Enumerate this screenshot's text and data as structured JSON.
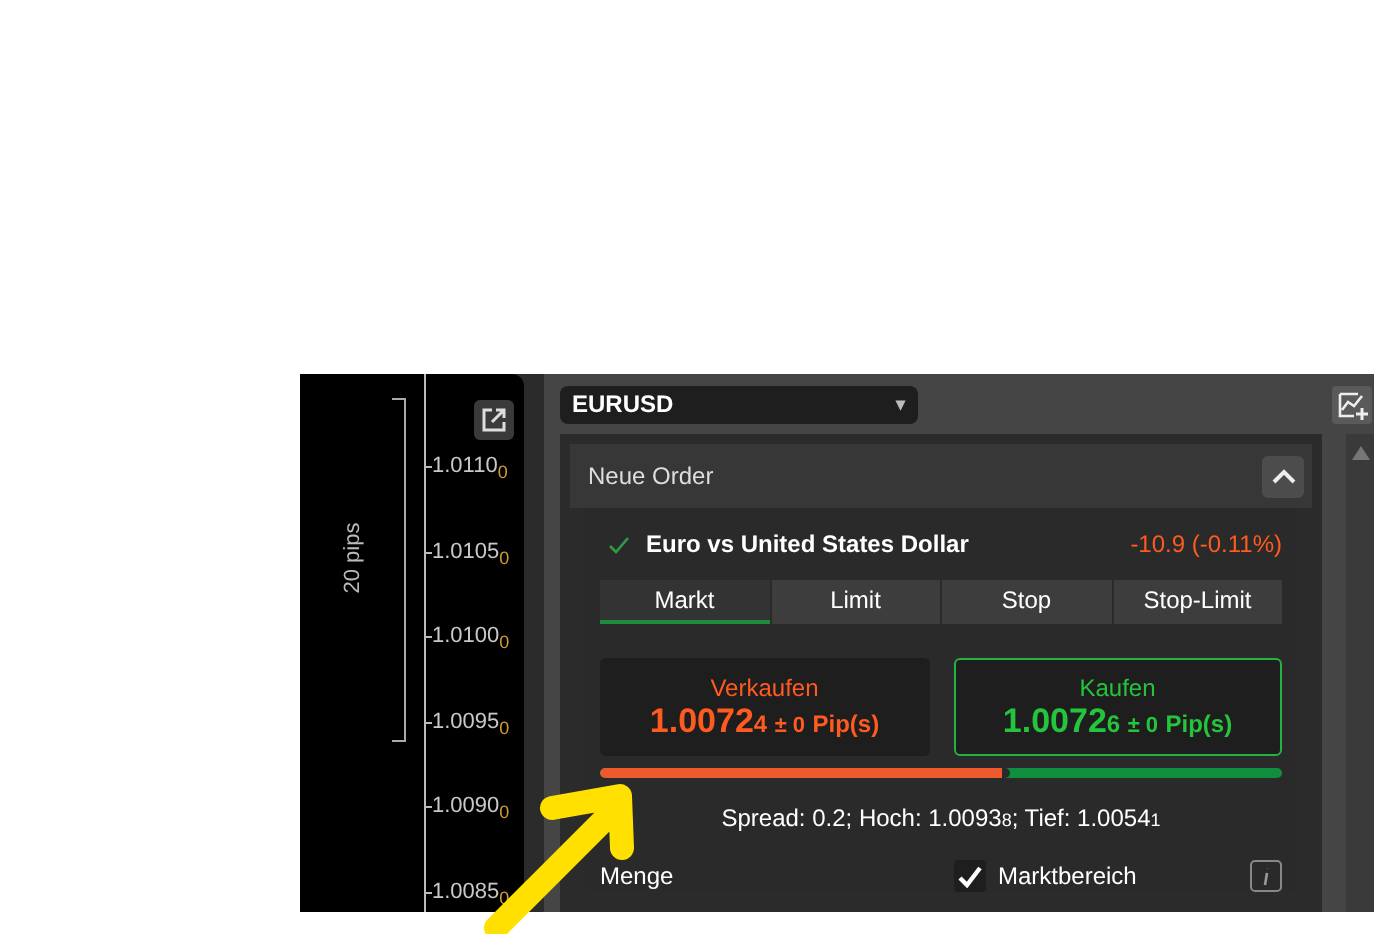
{
  "chart": {
    "range_label": "20 pips",
    "price_labels": [
      "1.0110$_{0}$",
      "1.0105$_{0}$",
      "1.0100$_{0}$",
      "1.0095$_{0}$",
      "1.0090$_{0}$",
      "1.0085$_{0}$"
    ]
  },
  "symbol_dropdown": {
    "value": "EURUSD",
    "caret": "▾"
  },
  "order_panel": {
    "title": "Neue Order",
    "expanded": true,
    "instrument": {
      "name": "Euro vs United States Dollar",
      "change": "-10.9 (-0.11%)"
    },
    "tabs": [
      {
        "label": "Markt",
        "selected": true
      },
      {
        "label": "Limit",
        "selected": false
      },
      {
        "label": "Stop",
        "selected": false
      },
      {
        "label": "Stop-Limit",
        "selected": false
      }
    ],
    "quotes": [
      {
        "kind": "sell",
        "label": "Verkaufen",
        "price": "1.0072",
        "pipette": "4",
        "tolerance": "± 0",
        "unit": "Pip(s)",
        "selected": false
      },
      {
        "kind": "buy",
        "label": "Kaufen",
        "price": "1.0072",
        "pipette": "6",
        "tolerance": "± 0",
        "unit": "Pip(s)",
        "selected": true
      }
    ],
    "sentiment": {
      "level": 0.6
    },
    "stats": "Spread: 0.2; Hoch: 1.0093$_{8}$; Tief: 1.0054$_{1}$",
    "quantity_label": "Menge",
    "market_range": {
      "label": "Marktbereich",
      "checked": true
    }
  }
}
